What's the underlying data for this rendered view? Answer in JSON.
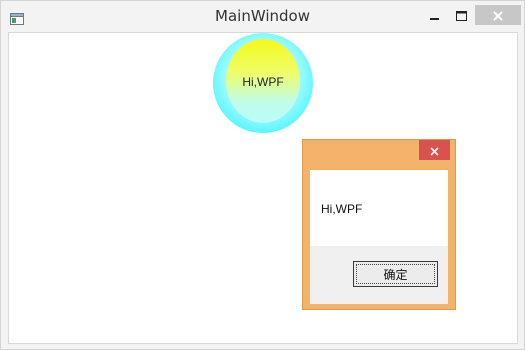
{
  "window": {
    "title": "MainWindow",
    "icon": "app-window-icon",
    "controls": [
      "minimize-icon",
      "maximize-icon",
      "close-icon"
    ]
  },
  "circle_button": {
    "label": "Hi,WPF",
    "colors": {
      "ring": "#15ecf5",
      "top": "#f4fa1a",
      "bottom": "#b9fdfd"
    }
  },
  "message_box": {
    "text": "Hi,WPF",
    "ok_label": "确定",
    "close_icon": "close-icon",
    "colors": {
      "frame": "#f3b36b",
      "close": "#d9524e"
    }
  }
}
